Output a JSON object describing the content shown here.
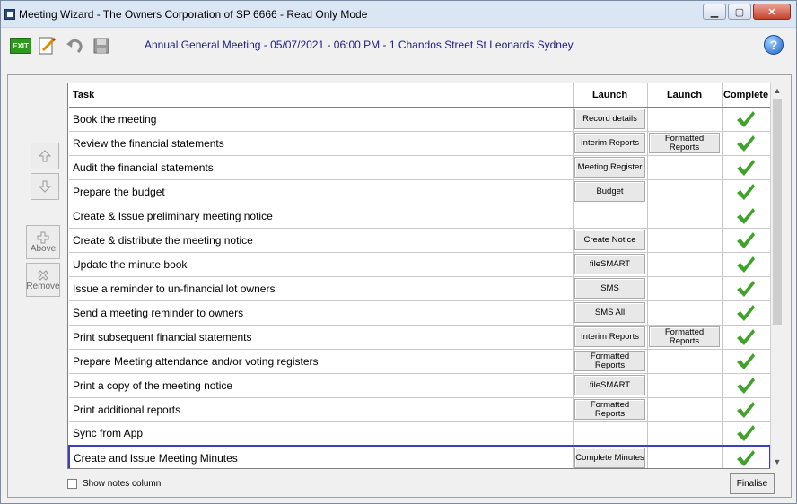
{
  "window": {
    "title": "Meeting Wizard - The Owners Corporation of SP 6666 - Read Only Mode"
  },
  "toolbar": {
    "exit_label": "EXIT"
  },
  "meeting_title": "Annual General Meeting - 05/07/2021 - 06:00 PM - 1 Chandos Street St Leonards Sydney",
  "side": {
    "above_label": "Above",
    "remove_label": "Remove"
  },
  "grid": {
    "headers": {
      "task": "Task",
      "launch1": "Launch",
      "launch2": "Launch",
      "complete": "Complete"
    },
    "rows": [
      {
        "task": "Book the meeting",
        "launch1": "Record details",
        "launch2": "",
        "complete": true
      },
      {
        "task": "Review the financial statements",
        "launch1": "Interim Reports",
        "launch2": "Formatted Reports",
        "complete": true
      },
      {
        "task": "Audit the financial statements",
        "launch1": "Meeting Register",
        "launch2": "",
        "complete": true
      },
      {
        "task": "Prepare the budget",
        "launch1": "Budget",
        "launch2": "",
        "complete": true
      },
      {
        "task": "Create & Issue preliminary meeting notice",
        "launch1": "",
        "launch2": "",
        "complete": true
      },
      {
        "task": "Create & distribute the meeting notice",
        "launch1": "Create Notice",
        "launch2": "",
        "complete": true
      },
      {
        "task": "Update the minute book",
        "launch1": "fileSMART",
        "launch2": "",
        "complete": true
      },
      {
        "task": "Issue a reminder to un-financial lot owners",
        "launch1": "SMS",
        "launch2": "",
        "complete": true
      },
      {
        "task": "Send a meeting reminder to owners",
        "launch1": "SMS All",
        "launch2": "",
        "complete": true
      },
      {
        "task": "Print subsequent financial statements",
        "launch1": "Interim Reports",
        "launch2": "Formatted Reports",
        "complete": true
      },
      {
        "task": "Prepare Meeting attendance and/or voting registers",
        "launch1": "Formatted Reports",
        "launch2": "",
        "complete": true
      },
      {
        "task": "Print a copy of the meeting notice",
        "launch1": "fileSMART",
        "launch2": "",
        "complete": true
      },
      {
        "task": "Print additional reports",
        "launch1": "Formatted Reports",
        "launch2": "",
        "complete": true
      },
      {
        "task": "Sync from App",
        "launch1": "",
        "launch2": "",
        "complete": true
      },
      {
        "task": "Create and Issue Meeting Minutes",
        "launch1": "Complete Minutes",
        "launch2": "",
        "complete": true
      }
    ]
  },
  "bottom": {
    "show_notes_label": "Show notes column",
    "finalise_label": "Finalise"
  },
  "colors": {
    "check_green": "#3fa32a",
    "title_blue": "#1a1a8a",
    "selection": "#3d3dc8"
  }
}
